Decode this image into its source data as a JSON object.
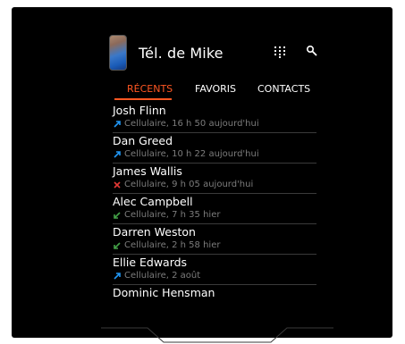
{
  "header": {
    "title": "Tél. de Mike",
    "grid_icon": "dialpad-icon",
    "search_icon": "search-icon"
  },
  "tabs": [
    {
      "label": "RÉCENTS",
      "active": true
    },
    {
      "label": "FAVORIS",
      "active": false
    },
    {
      "label": "CONTACTS",
      "active": false
    }
  ],
  "calls": [
    {
      "name": "Josh Flinn",
      "detail": "Cellulaire, 16 h 50 aujourd'hui",
      "type": "outgoing"
    },
    {
      "name": "Dan Greed",
      "detail": "Cellulaire, 10 h 22 aujourd'hui",
      "type": "outgoing"
    },
    {
      "name": "James Wallis",
      "detail": "Cellulaire, 9 h 05 aujourd'hui",
      "type": "missed"
    },
    {
      "name": "Alec Campbell",
      "detail": "Cellulaire, 7 h 35 hier",
      "type": "incoming"
    },
    {
      "name": "Darren Weston",
      "detail": "Cellulaire, 2 h 58 hier",
      "type": "incoming"
    },
    {
      "name": "Ellie Edwards",
      "detail": "Cellulaire, 2 août",
      "type": "outgoing"
    },
    {
      "name": "Dominic Hensman",
      "detail": "",
      "type": ""
    }
  ],
  "colors": {
    "accent": "#ff5722",
    "outgoing": "#2196f3",
    "missed": "#e53935",
    "incoming": "#43a047"
  }
}
